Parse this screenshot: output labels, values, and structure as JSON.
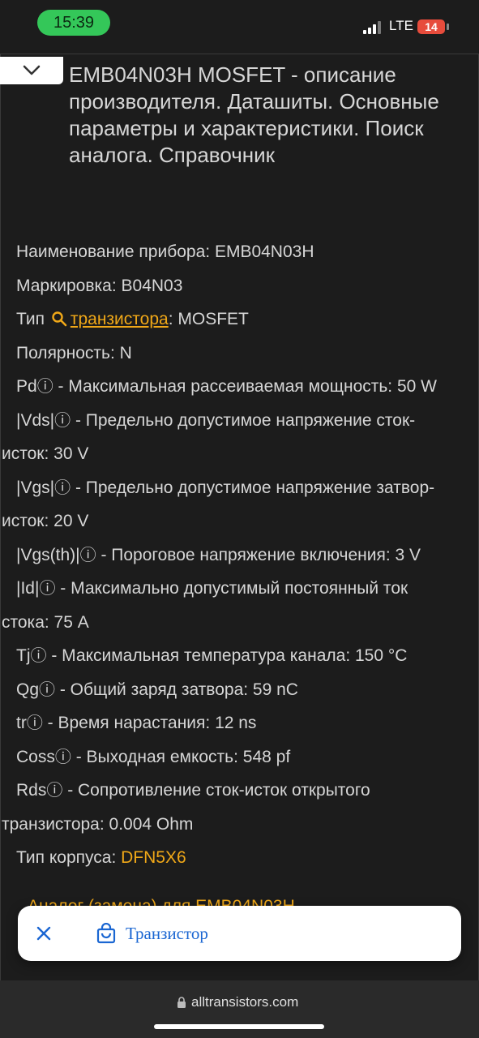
{
  "status_bar": {
    "time": "15:39",
    "network": "LTE",
    "battery": "14"
  },
  "page": {
    "title": "EMB04N03H MOSFET - описание производителя. Даташиты. Основные параметры и характеристики. Поиск аналога. Справочник",
    "specs": {
      "name_label": "Наименование прибора: ",
      "name_value": "EMB04N03H",
      "marking_label": "Маркировка: ",
      "marking_value": "B04N03",
      "type_label": "Тип ",
      "type_link": "транзистора",
      "type_value": ": MOSFET",
      "polarity": "Полярность: N",
      "pd_symbol": "Pd",
      "pd_text": " - Максимальная рассеиваемая мощность: 50 W",
      "vds_symbol": "|Vds|",
      "vds_text_1": " - Предельно допустимое напряжение сток-",
      "vds_text_2": "исток: 30 V",
      "vgs_symbol": "|Vgs|",
      "vgs_text_1": " - Предельно допустимое напряжение затвор-",
      "vgs_text_2": "исток: 20 V",
      "vgsth_symbol": "|Vgs(th)|",
      "vgsth_text": " - Пороговое напряжение включения: 3 V",
      "id_symbol": "|Id|",
      "id_text_1": " - Максимально допустимый постоянный ток",
      "id_text_2": "стока: 75 A",
      "tj_symbol": "Tj",
      "tj_text": " - Максимальная температура канала: 150 °C",
      "qg_symbol": "Qg",
      "qg_text": " - Общий заряд затвора: 59 nC",
      "tr_symbol": "tr",
      "tr_text": " - Время нарастания: 12 ns",
      "coss_symbol": "Coss",
      "coss_text": " - Выходная емкость: 548 pf",
      "rds_symbol": "Rds",
      "rds_text_1": " - Сопротивление сток-исток открытого",
      "rds_text_2": "транзистора: 0.004 Ohm",
      "package_label": "Тип корпуса: ",
      "package_value": "DFN5X6"
    },
    "info_mark": "ⓘ",
    "cut_off_line": "Аналог (замена) для EMB04N03H"
  },
  "float_card": {
    "label": "Транзистор"
  },
  "browser": {
    "url": "alltransistors.com"
  },
  "colors": {
    "background": "#1c1c1c",
    "text": "#d6d6d6",
    "link": "#f0a818",
    "card_text": "#1a66d2",
    "status_green": "#34c759",
    "battery_red": "#e74c3c"
  },
  "icons": [
    "chevron-down-icon",
    "search-icon",
    "info-icon",
    "close-icon",
    "shopping-bag-icon",
    "lock-icon",
    "signal-icon"
  ]
}
